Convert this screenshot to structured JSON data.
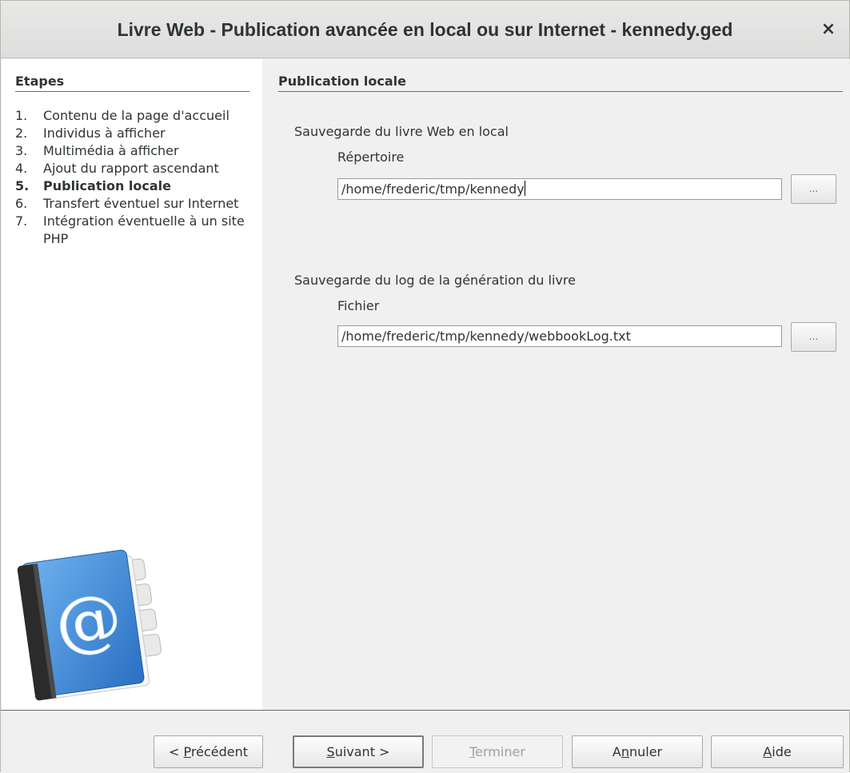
{
  "window": {
    "title": "Livre Web - Publication avancée en local ou sur Internet - kennedy.ged",
    "close_glyph": "×"
  },
  "steps": {
    "title": "Etapes",
    "items": [
      {
        "num": "1.",
        "label": "Contenu de la page d'accueil"
      },
      {
        "num": "2.",
        "label": "Individus à afficher"
      },
      {
        "num": "3.",
        "label": "Multimédia à afficher"
      },
      {
        "num": "4.",
        "label": "Ajout du rapport ascendant"
      },
      {
        "num": "5.",
        "label": "Publication locale"
      },
      {
        "num": "6.",
        "label": "Transfert éventuel sur Internet"
      },
      {
        "num": "7.",
        "label": "Intégration éventuelle à un site PHP"
      }
    ],
    "current_index": 4,
    "icon": "address-book-at-icon"
  },
  "main": {
    "section_title": "Publication locale",
    "local_save": {
      "heading": "Sauvegarde du livre Web en local",
      "field_label": "Répertoire",
      "value": "/home/frederic/tmp/kennedy",
      "browse_label": "..."
    },
    "log_save": {
      "heading": "Sauvegarde du log de la génération du livre",
      "field_label": "Fichier",
      "value": "/home/frederic/tmp/kennedy/webbookLog.txt",
      "browse_label": "..."
    }
  },
  "footer": {
    "previous": {
      "prefix": "< ",
      "mnemonic": "P",
      "rest": "récédent"
    },
    "next": {
      "prefix": "",
      "mnemonic": "S",
      "rest": "uivant >"
    },
    "finish": {
      "prefix": "",
      "mnemonic": "T",
      "rest": "erminer"
    },
    "cancel": {
      "prefix": "A",
      "mnemonic": "n",
      "rest": "nuler"
    },
    "help": {
      "prefix": "",
      "mnemonic": "A",
      "rest": "ide"
    }
  },
  "colors": {
    "book_blue": "#3a86d6",
    "book_spine": "#2b2b2b"
  }
}
